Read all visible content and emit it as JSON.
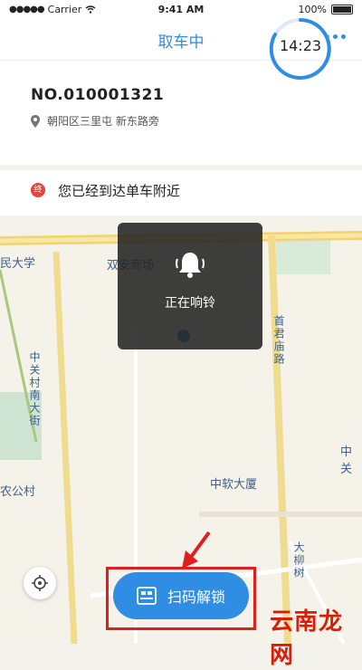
{
  "status_bar": {
    "carrier": "Carrier",
    "time": "9:41 AM",
    "battery": "100%"
  },
  "nav": {
    "title": "取车中"
  },
  "bike": {
    "number": "NO.010001321",
    "location": "朝阳区三里屯 新东路旁"
  },
  "timer": {
    "value": "14:23"
  },
  "banner": {
    "badge": "终",
    "text": "您已经到达单车附近"
  },
  "toast": {
    "text": "正在响铃"
  },
  "map": {
    "labels": [
      "民大学",
      "双安商场",
      "中关村南大街",
      "中软大厦",
      "首君庙路",
      "中关",
      "农公村",
      "大柳树"
    ]
  },
  "actions": {
    "scan_label": "扫码解锁"
  },
  "watermark": {
    "text": "云南龙网"
  },
  "colors": {
    "accent": "#2f8de4",
    "alert": "#e0463d",
    "highlight": "#e01e1e"
  }
}
